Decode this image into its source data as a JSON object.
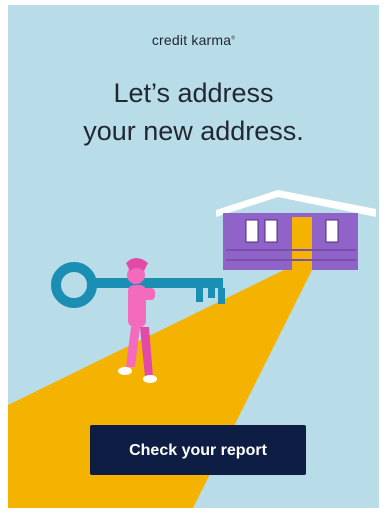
{
  "ad": {
    "brand_name": "credit karma",
    "headline_line1": "Let’s address",
    "headline_line2": "your new address.",
    "cta_label": "Check your report",
    "colors": {
      "background": "#b9dde8",
      "path": "#f5b301",
      "house": "#8f63c7",
      "key": "#1b8fb3",
      "person": "#f46bbd",
      "button": "#0e1d43"
    },
    "illustration_icons": [
      "house-icon",
      "key-icon",
      "person-icon",
      "path-shape"
    ]
  }
}
